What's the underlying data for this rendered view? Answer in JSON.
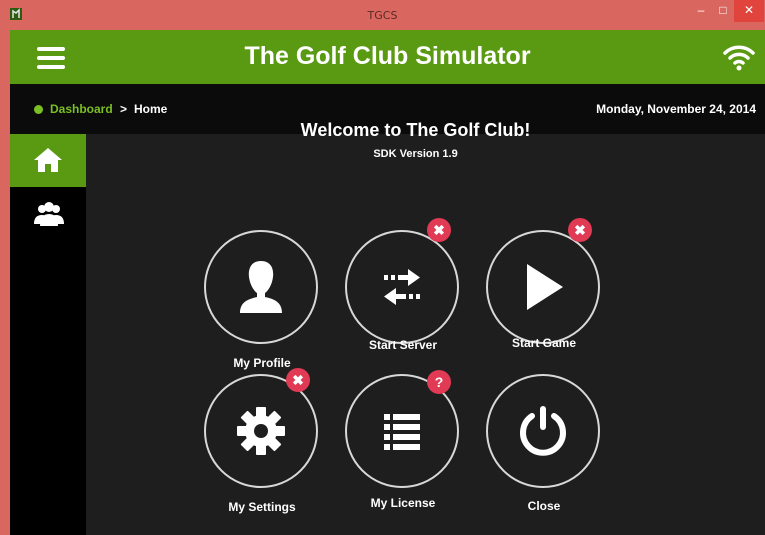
{
  "window": {
    "title": "TGCS",
    "minimize_glyph": "–",
    "maximize_glyph": "□",
    "close_glyph": "✕"
  },
  "header": {
    "title": "The Golf Club Simulator",
    "menu_icon": "hamburger-menu-icon",
    "status_icon": "wifi-icon"
  },
  "breadcrumb": {
    "root": "Dashboard",
    "separator": ">",
    "current": "Home",
    "date": "Monday, November 24, 2014"
  },
  "sidebar": {
    "items": [
      {
        "icon": "home-icon",
        "active": true
      },
      {
        "icon": "users-icon",
        "active": false
      }
    ]
  },
  "main": {
    "welcome": "Welcome to The Golf Club!",
    "sdk_version": "SDK Version 1.9",
    "tiles": [
      {
        "label": "My Profile",
        "icon": "user-icon",
        "badge": ""
      },
      {
        "label": "Start Server",
        "icon": "transfer-arrows-icon",
        "badge": "✖"
      },
      {
        "label": "Start Game",
        "icon": "play-icon",
        "badge": "✖"
      },
      {
        "label": "My Settings",
        "icon": "gear-icon",
        "badge": "✖"
      },
      {
        "label": "My License",
        "icon": "list-icon",
        "badge": "?"
      },
      {
        "label": "Close",
        "icon": "power-icon",
        "badge": ""
      }
    ]
  },
  "colors": {
    "header_green": "#5a9a12",
    "link_green": "#7bbf24",
    "badge_red": "#e03a55",
    "frame_red": "#d9675f"
  }
}
